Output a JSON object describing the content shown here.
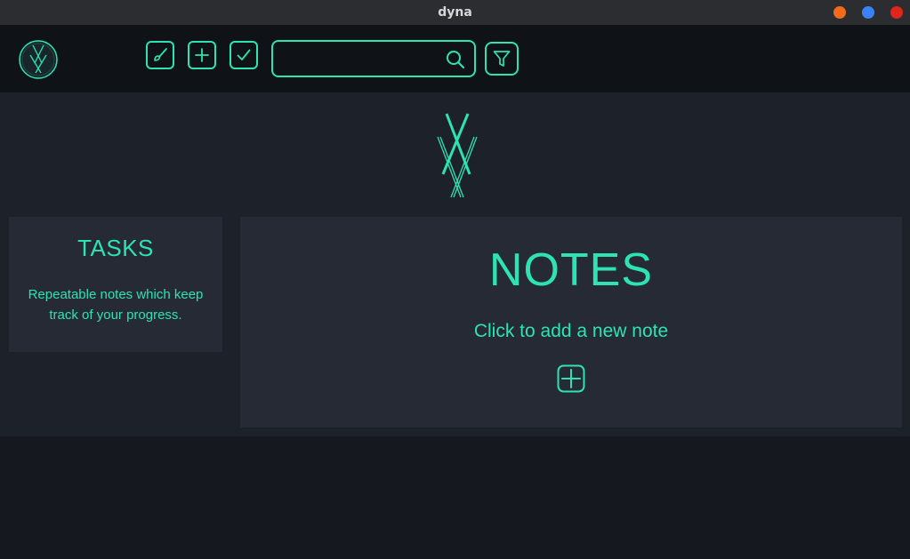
{
  "window": {
    "title": "dyna",
    "controls": {
      "minimize_color": "#f26b1d",
      "maximize_color": "#3b82f6",
      "close_color": "#e0261b"
    }
  },
  "theme": {
    "accent": "#2de3b3",
    "toolbar_bg": "#0f1216",
    "main_bg": "#1d212a",
    "card_bg": "#252a35"
  },
  "toolbar": {
    "logo_icon": "dyna-logo-icon",
    "buttons": [
      {
        "name": "edit-button",
        "icon": "brush-icon"
      },
      {
        "name": "add-button",
        "icon": "plus-icon"
      },
      {
        "name": "check-button",
        "icon": "check-icon"
      }
    ],
    "search": {
      "value": "",
      "placeholder": "",
      "icon": "search-icon"
    },
    "filter_icon": "filter-icon"
  },
  "main": {
    "logo_icon": "dyna-logo-icon",
    "tasks": {
      "title": "TASKS",
      "description": "Repeatable notes which keep track of your progress."
    },
    "notes": {
      "title": "NOTES",
      "subtitle": "Click to add a new note",
      "add_icon": "plus-box-icon"
    }
  }
}
